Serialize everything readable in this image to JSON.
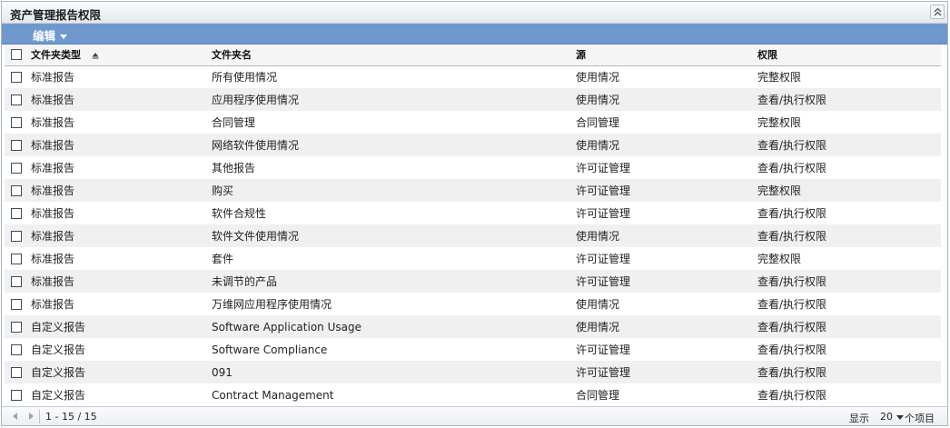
{
  "panel": {
    "title": "资产管理报告权限"
  },
  "toolbar": {
    "edit_label": "编辑"
  },
  "table": {
    "headers": {
      "type": "文件夹类型",
      "name": "文件夹名",
      "source": "源",
      "permission": "权限"
    },
    "rows": [
      {
        "type": "标准报告",
        "name": "所有使用情况",
        "source": "使用情况",
        "permission": "完整权限"
      },
      {
        "type": "标准报告",
        "name": "应用程序使用情况",
        "source": "使用情况",
        "permission": "查看/执行权限"
      },
      {
        "type": "标准报告",
        "name": "合同管理",
        "source": "合同管理",
        "permission": "完整权限"
      },
      {
        "type": "标准报告",
        "name": "网络软件使用情况",
        "source": "使用情况",
        "permission": "查看/执行权限"
      },
      {
        "type": "标准报告",
        "name": "其他报告",
        "source": "许可证管理",
        "permission": "查看/执行权限"
      },
      {
        "type": "标准报告",
        "name": "购买",
        "source": "许可证管理",
        "permission": "完整权限"
      },
      {
        "type": "标准报告",
        "name": "软件合规性",
        "source": "许可证管理",
        "permission": "查看/执行权限"
      },
      {
        "type": "标准报告",
        "name": "软件文件使用情况",
        "source": "使用情况",
        "permission": "查看/执行权限"
      },
      {
        "type": "标准报告",
        "name": "套件",
        "source": "许可证管理",
        "permission": "完整权限"
      },
      {
        "type": "标准报告",
        "name": "未调节的产品",
        "source": "许可证管理",
        "permission": "查看/执行权限"
      },
      {
        "type": "标准报告",
        "name": "万维网应用程序使用情况",
        "source": "使用情况",
        "permission": "查看/执行权限"
      },
      {
        "type": "自定义报告",
        "name": "Software Application Usage",
        "source": "使用情况",
        "permission": "查看/执行权限"
      },
      {
        "type": "自定义报告",
        "name": "Software Compliance",
        "source": "许可证管理",
        "permission": "查看/执行权限"
      },
      {
        "type": "自定义报告",
        "name": "091",
        "source": "许可证管理",
        "permission": "查看/执行权限"
      },
      {
        "type": "自定义报告",
        "name": "Contract Management",
        "source": "合同管理",
        "permission": "查看/执行权限"
      }
    ]
  },
  "footer": {
    "range": "1 - 15 / 15",
    "show_label": "显示",
    "per_page": "20",
    "items_label": "个项目"
  },
  "icons": {
    "collapse": "double-chevron-up-icon",
    "sort": "sort-ascending-icon",
    "prev": "triangle-left-icon",
    "next": "triangle-right-icon"
  },
  "colors": {
    "toolbar": "#6f98cf",
    "alt_row": "#f0f0f0"
  }
}
